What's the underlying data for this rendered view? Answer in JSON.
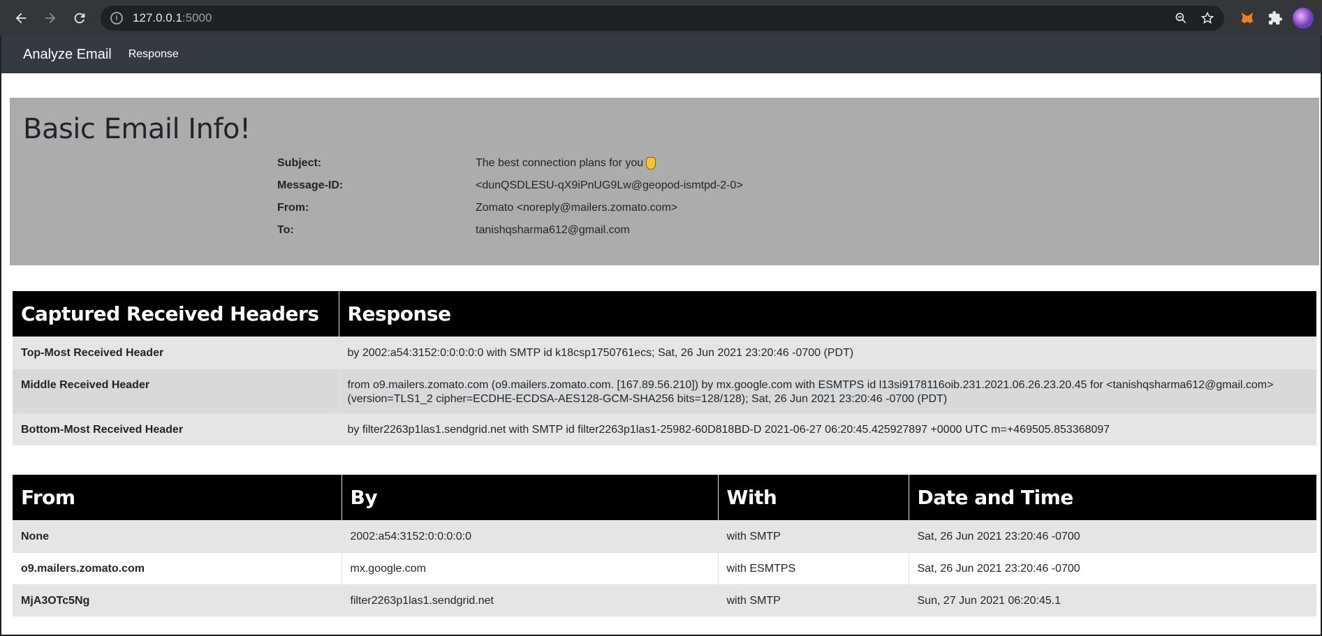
{
  "browser": {
    "url_host": "127.0.0.1",
    "url_port": ":5000"
  },
  "navbar": {
    "brand": "Analyze Email",
    "link": "Response"
  },
  "jumbotron": {
    "title": "Basic Email Info!",
    "rows": [
      {
        "label": "Subject:",
        "value": "The best connection plans for you"
      },
      {
        "label": "Message-ID:",
        "value": "<dunQSDLESU-qX9iPnUG9Lw@geopod-ismtpd-2-0>"
      },
      {
        "label": "From:",
        "value": "Zomato <noreply@mailers.zomato.com>"
      },
      {
        "label": "To:",
        "value": "tanishqsharma612@gmail.com"
      }
    ]
  },
  "headers_table": {
    "columns": [
      "Captured Received Headers",
      "Response"
    ],
    "rows": [
      {
        "name": "Top-Most Received Header",
        "value": "by 2002:a54:3152:0:0:0:0:0 with SMTP id k18csp1750761ecs; Sat, 26 Jun 2021 23:20:46 -0700 (PDT)"
      },
      {
        "name": "Middle Received Header",
        "value": "from o9.mailers.zomato.com (o9.mailers.zomato.com. [167.89.56.210]) by mx.google.com with ESMTPS id l13si9178116oib.231.2021.06.26.23.20.45 for <tanishqsharma612@gmail.com> (version=TLS1_2 cipher=ECDHE-ECDSA-AES128-GCM-SHA256 bits=128/128); Sat, 26 Jun 2021 23:20:46 -0700 (PDT)"
      },
      {
        "name": "Bottom-Most Received Header",
        "value": "by filter2263p1las1.sendgrid.net with SMTP id filter2263p1las1-25982-60D818BD-D 2021-06-27 06:20:45.425927897 +0000 UTC m=+469505.853368097"
      }
    ]
  },
  "hops_table": {
    "columns": [
      "From",
      "By",
      "With",
      "Date and Time"
    ],
    "rows": [
      {
        "from": "None",
        "by": "2002:a54:3152:0:0:0:0:0",
        "with": "with SMTP",
        "datetime": "Sat, 26 Jun 2021 23:20:46 -0700"
      },
      {
        "from": "o9.mailers.zomato.com",
        "by": "mx.google.com",
        "with": "with ESMTPS",
        "datetime": "Sat, 26 Jun 2021 23:20:46 -0700"
      },
      {
        "from": "MjA3OTc5Ng",
        "by": "filter2263p1las1.sendgrid.net",
        "with": "with SMTP",
        "datetime": "Sun, 27 Jun 2021 06:20:45.1"
      }
    ]
  }
}
